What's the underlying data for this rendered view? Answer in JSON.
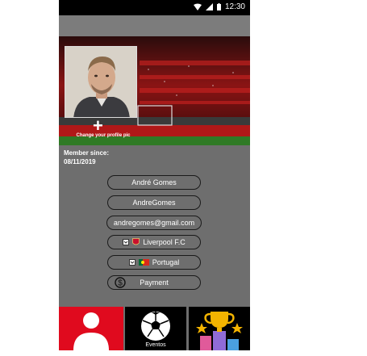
{
  "statusbar": {
    "time": "12:30"
  },
  "profile": {
    "change_pic_label": "Change your profile pic",
    "member_since_label": "Member since:",
    "member_since_date": "08/11/2019"
  },
  "fields": {
    "full_name": "André Gomes",
    "username": "AndreGomes",
    "email": "andregomes@gmail.com",
    "club": "Liverpool F.C",
    "country": "Portugal",
    "payment": "Payment"
  },
  "bottom_nav": {
    "events_label": "Eventos"
  },
  "colors": {
    "background": "#6e6e6e",
    "accent_red": "#e00a1e",
    "pill_border": "#1a1a1a"
  }
}
